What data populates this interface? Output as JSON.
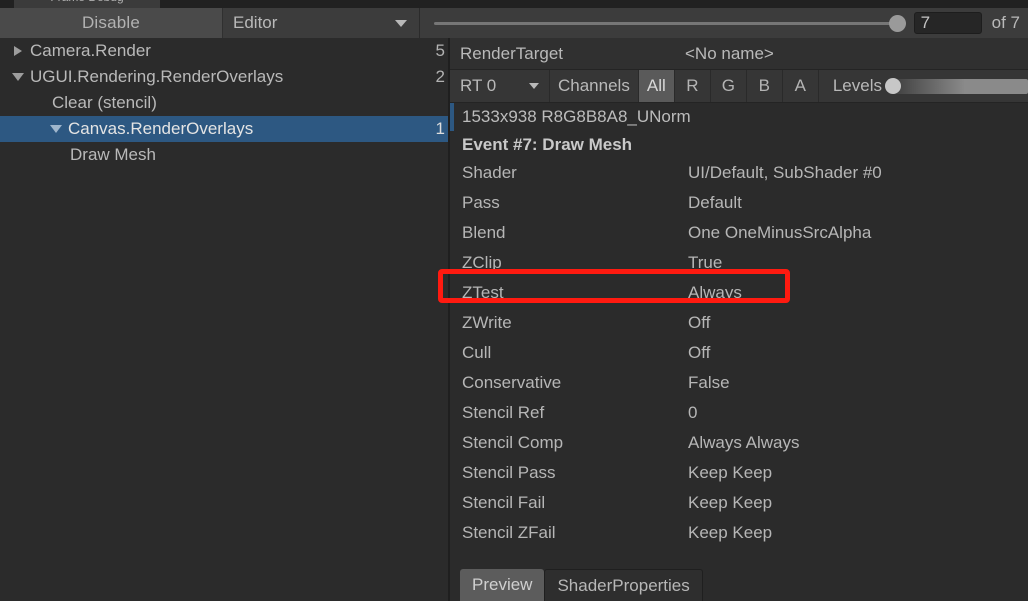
{
  "window": {
    "ghost_tab_label": "Frame Debug"
  },
  "toolbar": {
    "disable_label": "Disable",
    "target_dropdown": "Editor",
    "event_value": "7",
    "event_total_label": "of 7",
    "slider_position_percent": 100
  },
  "tree": {
    "rows": [
      {
        "label": "Camera.Render",
        "count": "5",
        "indent": 14,
        "foldout": "closed",
        "selected": false
      },
      {
        "label": "UGUI.Rendering.RenderOverlays",
        "count": "2",
        "indent": 14,
        "foldout": "open",
        "selected": false
      },
      {
        "label": "Clear (stencil)",
        "count": "",
        "indent": 52,
        "foldout": "none",
        "selected": false
      },
      {
        "label": "Canvas.RenderOverlays",
        "count": "1",
        "indent": 52,
        "foldout": "open",
        "selected": true
      },
      {
        "label": "Draw Mesh",
        "count": "",
        "indent": 70,
        "foldout": "none",
        "selected": false
      }
    ]
  },
  "render_target": {
    "title": "RenderTarget",
    "name": "<No name>",
    "rt_select": "RT 0",
    "channels_label": "Channels",
    "channels": [
      {
        "label": "All",
        "active": true
      },
      {
        "label": "R",
        "active": false
      },
      {
        "label": "G",
        "active": false
      },
      {
        "label": "B",
        "active": false
      },
      {
        "label": "A",
        "active": false
      }
    ],
    "levels_label": "Levels",
    "format": "1533x938 R8G8B8A8_UNorm"
  },
  "event": {
    "title": "Event #7: Draw Mesh",
    "properties": [
      {
        "name": "Shader",
        "value": "UI/Default, SubShader #0"
      },
      {
        "name": "Pass",
        "value": "Default"
      },
      {
        "name": "Blend",
        "value": "One OneMinusSrcAlpha"
      },
      {
        "name": "ZClip",
        "value": "True"
      },
      {
        "name": "ZTest",
        "value": "Always"
      },
      {
        "name": "ZWrite",
        "value": "Off"
      },
      {
        "name": "Cull",
        "value": "Off"
      },
      {
        "name": "Conservative",
        "value": "False"
      },
      {
        "name": "Stencil Ref",
        "value": "0"
      },
      {
        "name": "Stencil Comp",
        "value": "Always Always"
      },
      {
        "name": "Stencil Pass",
        "value": "Keep Keep"
      },
      {
        "name": "Stencil Fail",
        "value": "Keep Keep"
      },
      {
        "name": "Stencil ZFail",
        "value": "Keep Keep"
      }
    ]
  },
  "annotation": {
    "highlight_color": "#ff1a10",
    "highlighted_property": "ZTest"
  },
  "bottom_tabs": [
    {
      "label": "Preview",
      "active": true
    },
    {
      "label": "ShaderProperties",
      "active": false
    }
  ]
}
